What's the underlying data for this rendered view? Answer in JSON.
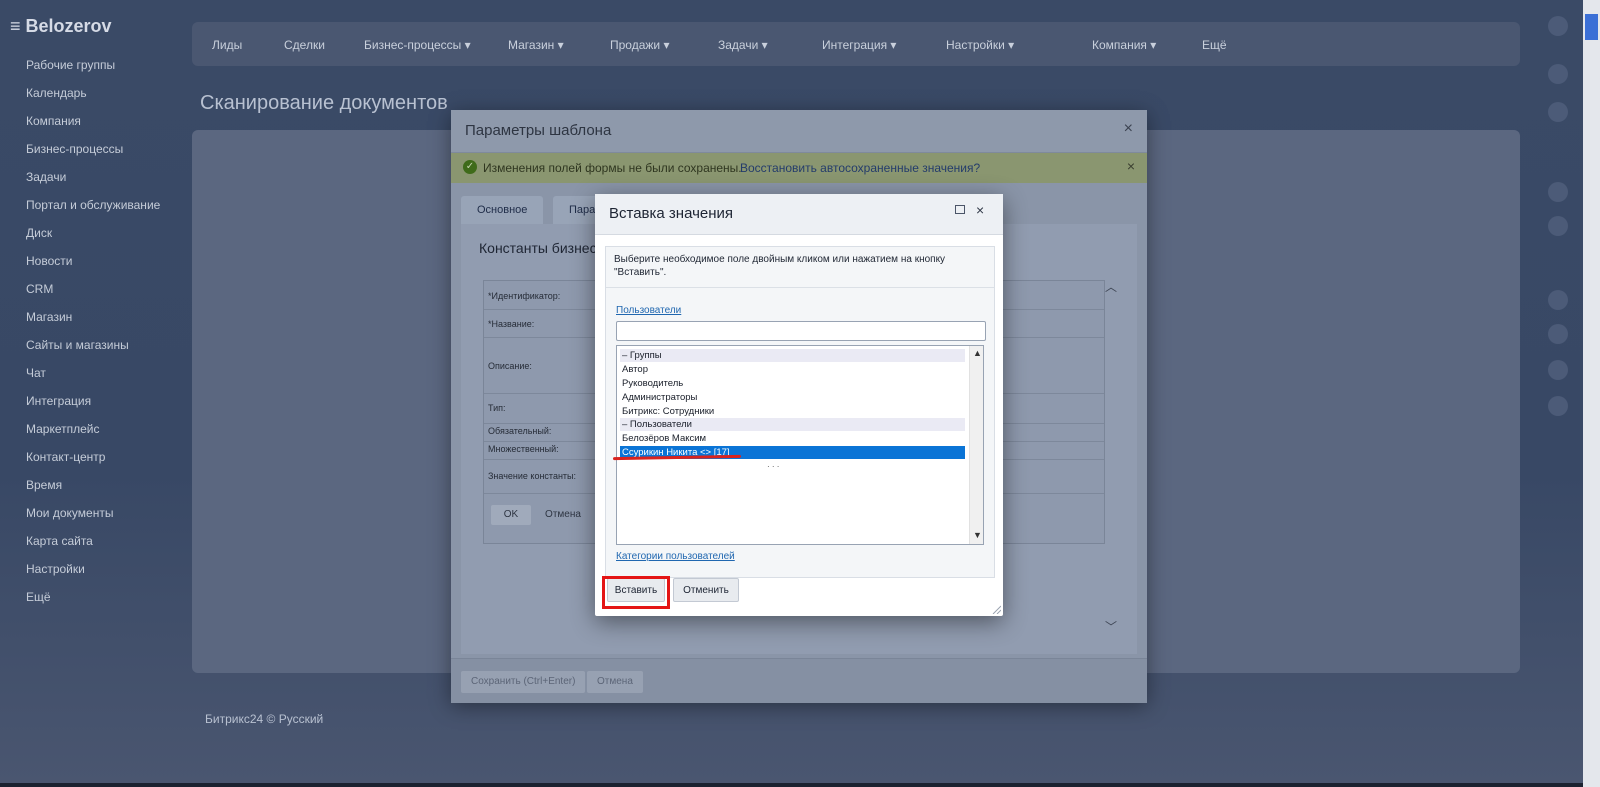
{
  "app": {
    "logo": "≡ Belozerov"
  },
  "top_nav": [
    "Лиды",
    "Сделки",
    "Бизнес-процессы ▾",
    "Магазин ▾",
    "Продажи ▾",
    "Задачи ▾",
    "Интеграция ▾",
    "Настройки ▾",
    "Компания ▾",
    "Ещё"
  ],
  "page_title": "Сканирование документов",
  "left_nav": [
    "Рабочие группы",
    "Календарь",
    "Компания",
    "Бизнес-процессы",
    "Задачи",
    "Портал и обслуживание",
    "Диск",
    "Новости",
    "CRM",
    "Магазин",
    "Сайты и магазины",
    "Чат",
    "Интеграция",
    "Маркетплейс",
    "Контакт-центр",
    "Время",
    "Мои документы",
    "Карта сайта",
    "Настройки",
    "Ещё"
  ],
  "footer_text": "Битрикс24 © Русский",
  "template_dialog": {
    "title": "Параметры шаблона",
    "close": "×",
    "notice_text": "Изменения полей формы не были сохранены.",
    "notice_link": "Восстановить автосохраненные значения?",
    "notice_close": "×",
    "tabs": [
      "Основное",
      "Пара"
    ],
    "constants_title": "Константы бизнес",
    "fields": [
      "*Идентификатор:",
      "*Название:",
      "Описание:",
      "Тип:",
      "Обязательный:",
      "Множественный:",
      "Значение константы:"
    ],
    "ok_label": "OK",
    "cancel_small_label": "Отмена",
    "save_label": "Сохранить (Ctrl+Enter)",
    "cancel_label": "Отмена"
  },
  "insert_dialog": {
    "title": "Вставка значения",
    "maximize_icon": "maximize-icon",
    "close": "×",
    "hint": "Выберите необходимое поле двойным кликом или нажатием на кнопку \"Вставить\".",
    "users_link": "Пользователи",
    "search_value": "",
    "list": [
      {
        "text": "– Группы",
        "kind": "group"
      },
      {
        "text": "Автор",
        "kind": "item"
      },
      {
        "text": "Руководитель",
        "kind": "item"
      },
      {
        "text": "Администраторы",
        "kind": "item"
      },
      {
        "text": "Битрикс: Сотрудники",
        "kind": "item"
      },
      {
        "text": "– Пользователи",
        "kind": "group"
      },
      {
        "text": "Белозёров Максим",
        "kind": "item"
      },
      {
        "text": "Ссурикин Никита <> [17]",
        "kind": "selected"
      }
    ],
    "categories_link": "Категории пользователей",
    "insert_label": "Вставить",
    "cancel_label": "Отменить"
  },
  "colors": {
    "selection": "#0a74d6",
    "annotation": "#e41515",
    "link": "#2067b0"
  }
}
